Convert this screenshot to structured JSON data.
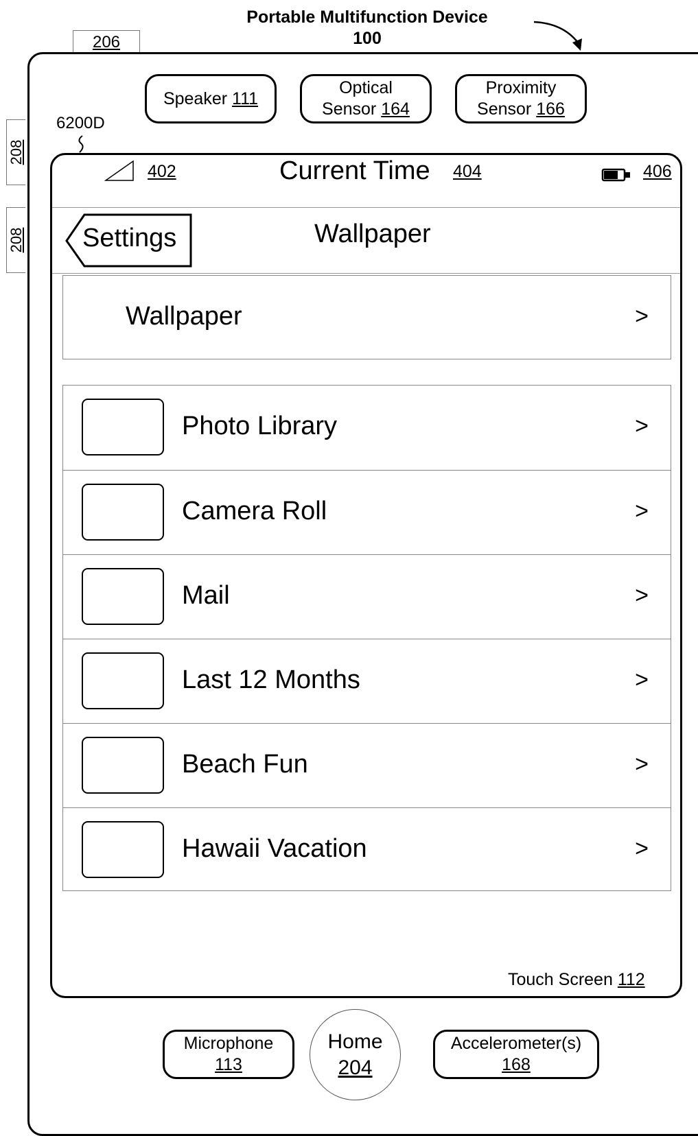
{
  "device": {
    "title": "Portable Multifunction Device",
    "number": "100"
  },
  "ref_206": "206",
  "side_buttons": [
    "208",
    "208"
  ],
  "sensors": [
    {
      "label": "Speaker",
      "ref": "111"
    },
    {
      "label_line1": "Optical",
      "label": "Sensor",
      "ref": "164"
    },
    {
      "label_line1": "Proximity",
      "label": "Sensor",
      "ref": "166"
    }
  ],
  "screen_ref": "6200D",
  "status_bar": {
    "signal_ref": "402",
    "time_label": "Current Time",
    "time_ref": "404",
    "battery_ref": "406"
  },
  "nav": {
    "back_label": "Settings",
    "title": "Wallpaper"
  },
  "wallpaper_row": {
    "label": "Wallpaper",
    "chevron": ">"
  },
  "albums": [
    {
      "label": "Photo Library",
      "chevron": ">"
    },
    {
      "label": "Camera Roll",
      "chevron": ">"
    },
    {
      "label": "Mail",
      "chevron": ">"
    },
    {
      "label": "Last 12 Months",
      "chevron": ">"
    },
    {
      "label": "Beach Fun",
      "chevron": ">"
    },
    {
      "label": "Hawaii Vacation",
      "chevron": ">"
    }
  ],
  "touch_screen": {
    "label": "Touch Screen",
    "ref": "112"
  },
  "bottom": {
    "microphone": {
      "label": "Microphone",
      "ref": "113"
    },
    "home": {
      "label": "Home",
      "ref": "204"
    },
    "accelerometer": {
      "label": "Accelerometer(s)",
      "ref": "168"
    }
  }
}
